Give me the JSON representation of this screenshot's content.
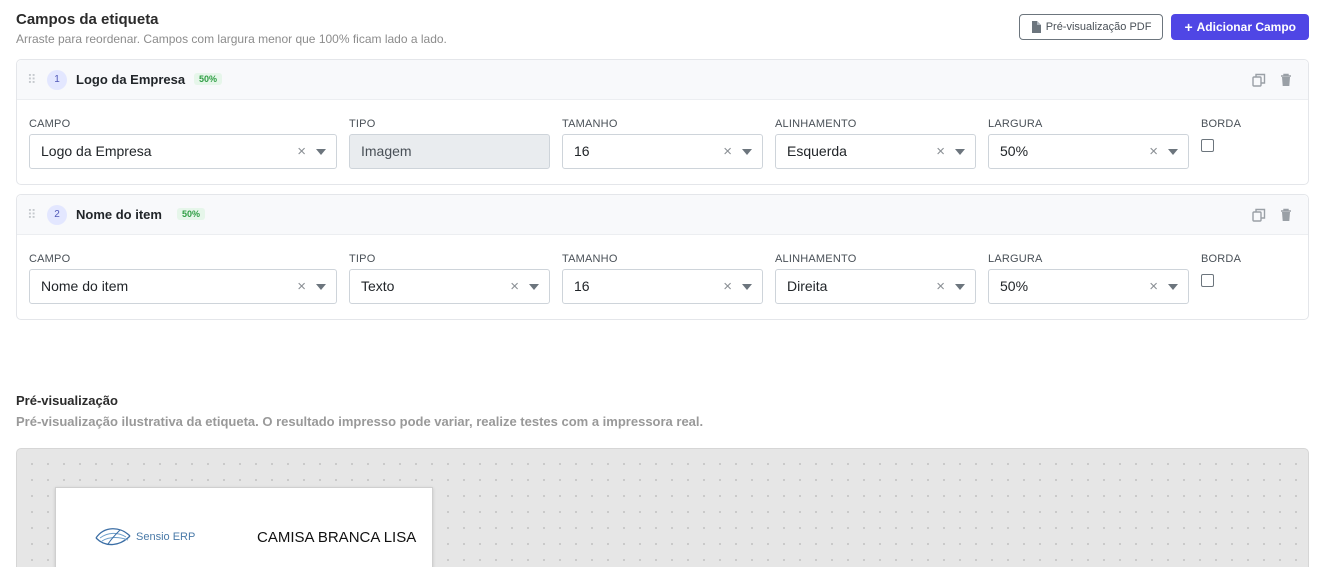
{
  "header": {
    "title": "Campos da etiqueta",
    "subtitle": "Arraste para reordenar. Campos com largura menor que 100% ficam lado a lado.",
    "pdf_button": "Pré-visualização PDF",
    "add_button": "Adicionar Campo",
    "add_button_icon": "+"
  },
  "labels": {
    "campo": "CAMPO",
    "tipo": "TIPO",
    "tamanho": "TAMANHO",
    "alinhamento": "ALINHAMENTO",
    "largura": "LARGURA",
    "borda": "BORDA"
  },
  "fields": [
    {
      "number": "1",
      "name": "Logo da Empresa",
      "badge": "50%",
      "campo": "Logo da Empresa",
      "tipo": "Imagem",
      "tamanho": "16",
      "alinhamento": "Esquerda",
      "largura": "50%",
      "borda": false
    },
    {
      "number": "2",
      "name": "Nome do item",
      "badge": "50%",
      "campo": "Nome do item",
      "tipo": "Texto",
      "tamanho": "16",
      "alinhamento": "Direita",
      "largura": "50%",
      "borda": false
    }
  ],
  "clear_symbol": "×",
  "preview": {
    "title": "Pré-visualização",
    "subtitle": "Pré-visualização ilustrativa da etiqueta. O resultado impresso pode variar, realize testes com a impressora real.",
    "logo_text": "Sensio ERP",
    "item_text": "CAMISA BRANCA LISA"
  },
  "colors": {
    "accent": "#4f46e5",
    "badge_green": "#2f9e44"
  }
}
